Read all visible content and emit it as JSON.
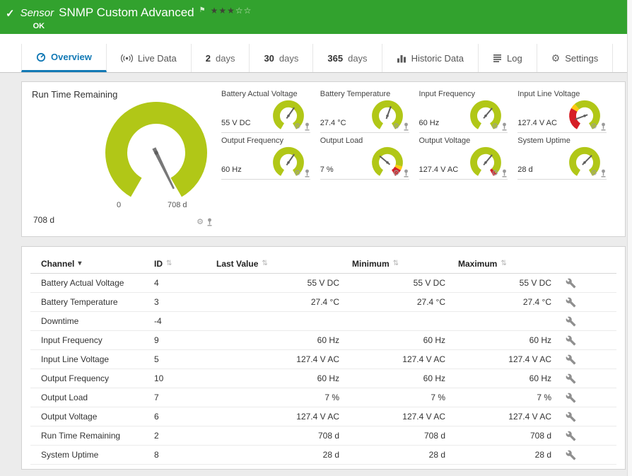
{
  "header": {
    "kind_label": "Sensor",
    "title": "SNMP Custom Advanced",
    "status": "OK"
  },
  "icons": {
    "check": "✓",
    "flag": "⚑",
    "stars_filled": "★★★",
    "stars_empty": "☆☆",
    "gear": "⚙",
    "sort_active": "▾",
    "sort": "⇅"
  },
  "colors": {
    "header_green": "#32a22e",
    "tab_active_blue": "#1279b5",
    "gauge_lime": "#b1c717",
    "alert_red": "#d61f26",
    "warn_yellow": "#fec90f"
  },
  "tabs": {
    "items": [
      {
        "label": "Overview"
      },
      {
        "label": "Live Data"
      },
      {
        "num": "2",
        "unit": "days"
      },
      {
        "num": "30",
        "unit": "days"
      },
      {
        "num": "365",
        "unit": "days"
      },
      {
        "label": "Historic Data"
      },
      {
        "label": "Log"
      },
      {
        "label": "Settings"
      }
    ]
  },
  "gauges": {
    "main": {
      "title": "Run Time Remaining",
      "value": "708 d",
      "scale_start": "0",
      "scale_end": "708 d"
    },
    "items": [
      {
        "title": "Battery Actual Voltage",
        "value": "55 V DC"
      },
      {
        "title": "Battery Temperature",
        "value": "27.4 °C"
      },
      {
        "title": "Input Frequency",
        "value": "60 Hz"
      },
      {
        "title": "Input Line Voltage",
        "value": "127.4 V AC"
      },
      {
        "title": "Output Frequency",
        "value": "60 Hz"
      },
      {
        "title": "Output Load",
        "value": "7 %"
      },
      {
        "title": "Output Voltage",
        "value": "127.4 V AC"
      },
      {
        "title": "System Uptime",
        "value": "28 d"
      }
    ]
  },
  "table": {
    "headers": {
      "channel": "Channel",
      "id": "ID",
      "last": "Last Value",
      "min": "Minimum",
      "max": "Maximum"
    },
    "rows": [
      {
        "channel": "Battery Actual Voltage",
        "id": "4",
        "last": "55 V DC",
        "min": "55 V DC",
        "max": "55 V DC"
      },
      {
        "channel": "Battery Temperature",
        "id": "3",
        "last": "27.4 °C",
        "min": "27.4 °C",
        "max": "27.4 °C"
      },
      {
        "channel": "Downtime",
        "id": "-4",
        "last": "",
        "min": "",
        "max": ""
      },
      {
        "channel": "Input Frequency",
        "id": "9",
        "last": "60 Hz",
        "min": "60 Hz",
        "max": "60 Hz"
      },
      {
        "channel": "Input Line Voltage",
        "id": "5",
        "last": "127.4 V AC",
        "min": "127.4 V AC",
        "max": "127.4 V AC"
      },
      {
        "channel": "Output Frequency",
        "id": "10",
        "last": "60 Hz",
        "min": "60 Hz",
        "max": "60 Hz"
      },
      {
        "channel": "Output Load",
        "id": "7",
        "last": "7 %",
        "min": "7 %",
        "max": "7 %"
      },
      {
        "channel": "Output Voltage",
        "id": "6",
        "last": "127.4 V AC",
        "min": "127.4 V AC",
        "max": "127.4 V AC"
      },
      {
        "channel": "Run Time Remaining",
        "id": "2",
        "last": "708 d",
        "min": "708 d",
        "max": "708 d"
      },
      {
        "channel": "System Uptime",
        "id": "8",
        "last": "28 d",
        "min": "28 d",
        "max": "28 d"
      }
    ]
  }
}
